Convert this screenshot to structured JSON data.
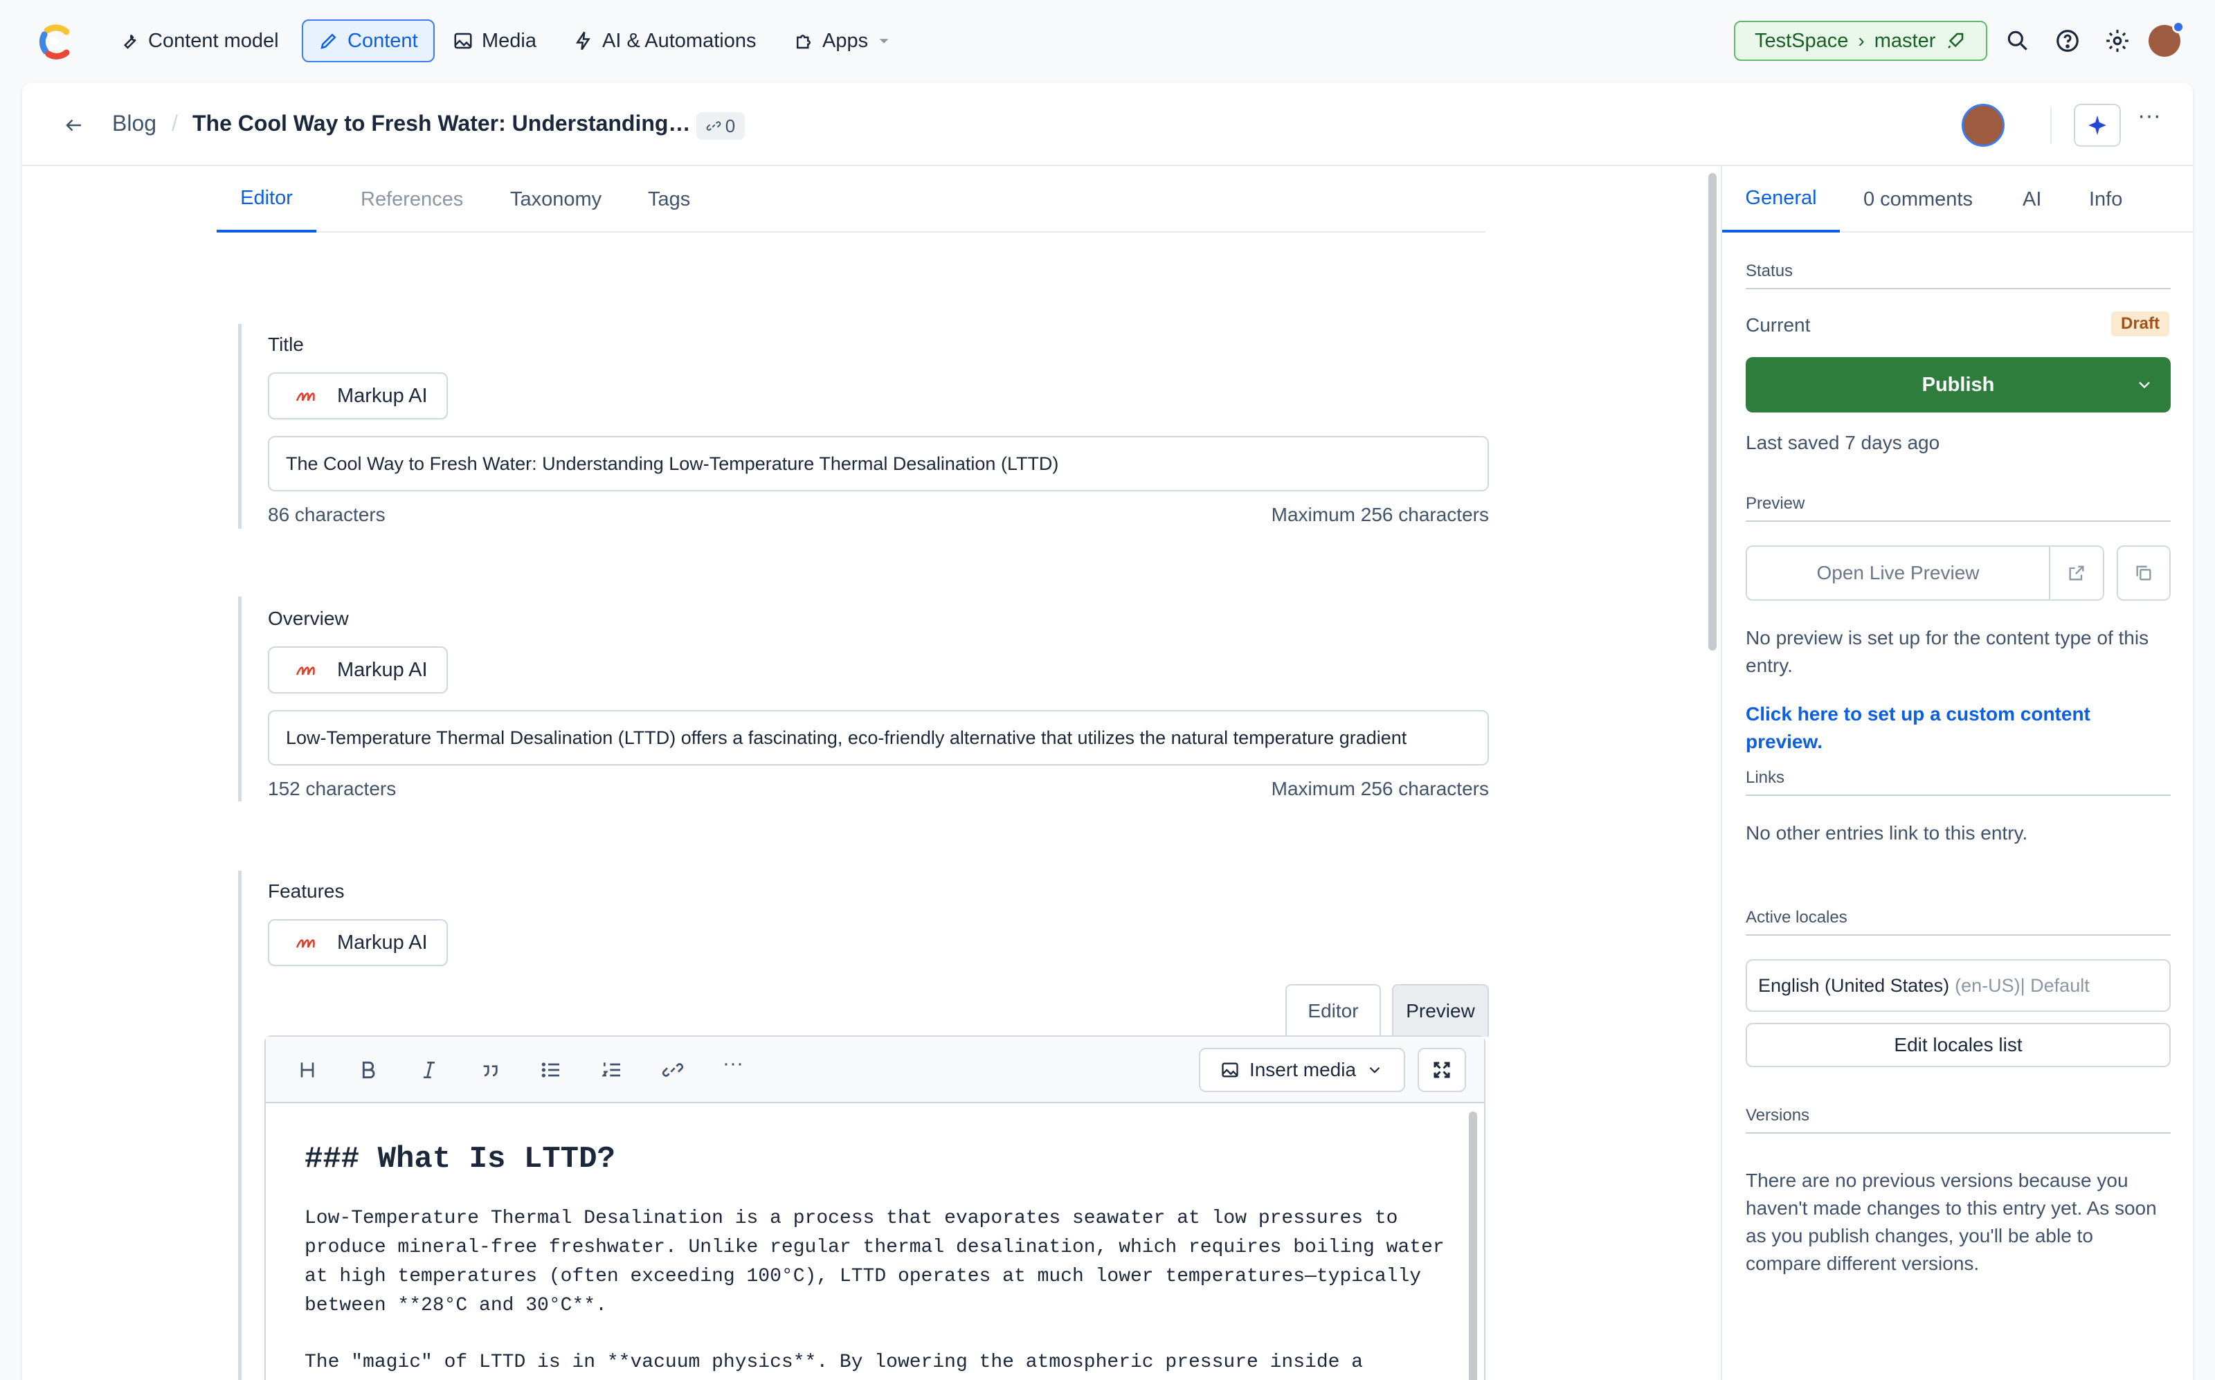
{
  "nav": {
    "content_model": "Content model",
    "content": "Content",
    "media": "Media",
    "ai": "AI & Automations",
    "apps": "Apps"
  },
  "space": {
    "name": "TestSpace",
    "env": "master"
  },
  "header": {
    "breadcrumb": "Blog",
    "title": "The Cool Way to Fresh Water: Understanding…",
    "ref_count": "0"
  },
  "tabs": [
    "Editor",
    "References",
    "Taxonomy",
    "Tags"
  ],
  "fields": {
    "markup_label": "Markup AI",
    "title": {
      "label": "Title",
      "value": "The Cool Way to Fresh Water: Understanding Low-Temperature Thermal Desalination (LTTD)",
      "count": "86 characters",
      "max": "Maximum 256 characters"
    },
    "overview": {
      "label": "Overview",
      "value": "Low-Temperature Thermal Desalination (LTTD) offers a fascinating, eco-friendly alternative that utilizes the natural temperature gradient",
      "count": "152 characters",
      "max": "Maximum 256 characters"
    },
    "features": {
      "label": "Features",
      "mode_editor": "Editor",
      "mode_preview": "Preview",
      "insert_media": "Insert media",
      "heading": "### What Is LTTD?",
      "p1": "Low-Temperature Thermal Desalination is a process that evaporates seawater at low pressures to produce mineral-free freshwater. Unlike regular thermal desalination, which requires boiling water at high temperatures (often exceeding 100°C), LTTD operates at much lower temperatures—typically between **28°C and 30°C**.",
      "p2": "The \"magic\" of LTTD is in **vacuum physics**. By lowering the atmospheric pressure inside a"
    }
  },
  "sidebar": {
    "tabs": [
      "General",
      "0 comments",
      "AI",
      "Info"
    ],
    "status": "Status",
    "current": "Current",
    "draft": "Draft",
    "publish": "Publish",
    "last_saved": "Last saved 7 days ago",
    "preview": "Preview",
    "open_preview": "Open Live Preview",
    "no_preview": "No preview is set up for the content type of this entry.",
    "setup_link": "Click here to set up a custom content preview.",
    "links": "Links",
    "no_links": "No other entries link to this entry.",
    "locales": "Active locales",
    "locale_name": "English (United States)",
    "locale_code": "(en-US)| Default",
    "edit_locales": "Edit locales list",
    "versions": "Versions",
    "versions_text": "There are no previous versions because you haven't made changes to this entry yet. As soon as you publish changes, you'll be able to compare different versions."
  },
  "colors": {
    "accent": "#0b5fe0",
    "publish": "#2e7d3d",
    "draft_bg": "#fbe9d0",
    "draft_text": "#a4521c"
  }
}
